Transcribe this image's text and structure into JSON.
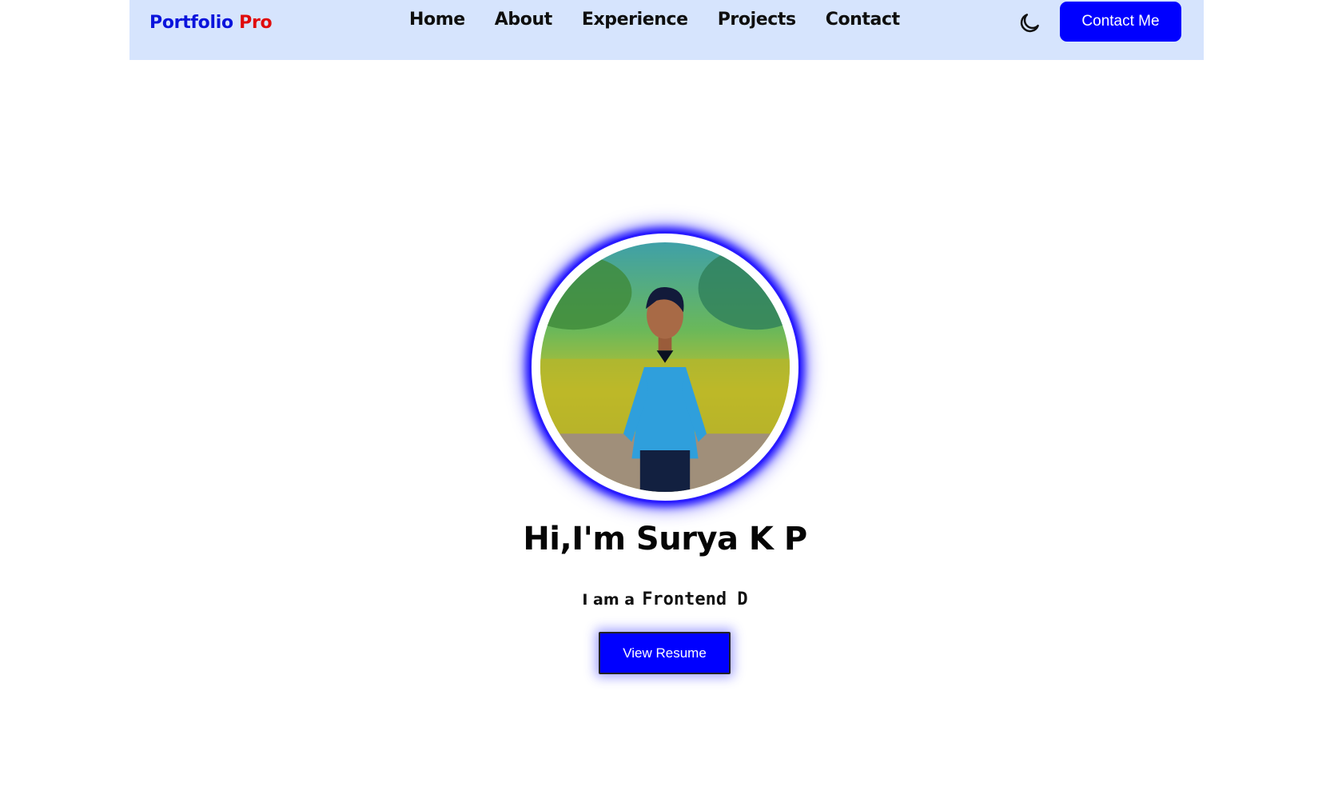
{
  "nav": {
    "brand_part1": "Portfolio",
    "brand_part2": "Pro",
    "links": [
      "Home",
      "About",
      "Experience",
      "Projects",
      "Contact"
    ],
    "theme_icon": "moon-icon",
    "contact_button": "Contact Me"
  },
  "hero": {
    "greeting": "Hi,I'm Surya K P",
    "role_prefix": "I am a",
    "role_typed": "Frontend D",
    "resume_button": "View Resume"
  },
  "colors": {
    "brand_blue": "#0a14dc",
    "brand_red": "#e00b0b",
    "accent": "#0000ff",
    "navbar_bg": "#d6e4fd"
  }
}
